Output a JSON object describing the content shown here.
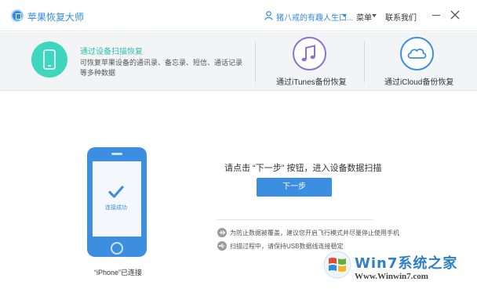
{
  "app": {
    "title": "苹果恢复大师"
  },
  "header": {
    "user_name": "猪八戒的有趣人生口...",
    "menu_label": "菜单",
    "contact_label": "联系我们"
  },
  "modes": {
    "device": {
      "title": "通过设备扫描恢复",
      "description": "可恢复苹果设备的通讯录、备忘录、短信、通话记录等多种数据"
    },
    "itunes": {
      "label": "通过iTunes备份恢复"
    },
    "icloud": {
      "label": "通过iCloud备份恢复"
    }
  },
  "phone": {
    "status": "连接成功",
    "caption": "“iPhone”已连接"
  },
  "main": {
    "instruction": "请点击 “下一步” 按钮，进入设备数据扫描",
    "next_label": "下一步",
    "tips": [
      "为防止数据被覆盖，建议您开启飞行模式并尽量停止使用手机",
      "扫描过程中，请保持USB数据线连接稳定"
    ]
  },
  "watermark": {
    "name": "Win7系统之家",
    "url": "Www.Winwin7.com"
  },
  "colors": {
    "accent": "#2f8be0",
    "teal": "#3fd6bf",
    "purple": "#8a73d2",
    "button": "#3c8fe0"
  },
  "icons": [
    "app-logo-icon",
    "user-icon",
    "caret-down-icon",
    "minimize-icon",
    "close-icon",
    "phone-icon",
    "music-note-icon",
    "cloud-icon",
    "checkmark-icon",
    "airplane-icon",
    "usb-icon",
    "windows-logo-icon"
  ]
}
